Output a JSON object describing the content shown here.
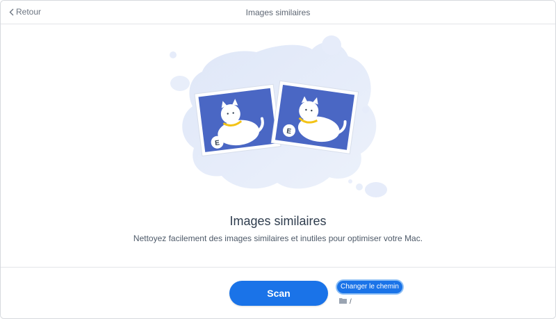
{
  "header": {
    "back_label": "Retour",
    "title": "Images similaires"
  },
  "main": {
    "heading": "Images similaires",
    "description": "Nettoyez facilement des images similaires et inutiles pour optimiser votre Mac."
  },
  "footer": {
    "scan_label": "Scan",
    "change_path_label": "Changer le chemin",
    "current_path": "/"
  },
  "colors": {
    "accent": "#1a73e8",
    "photo_blue": "#4a67c4",
    "blob": "#e4ebfa",
    "collar": "#f3c316"
  },
  "icons": [
    "chevron-left-icon",
    "folder-icon"
  ]
}
